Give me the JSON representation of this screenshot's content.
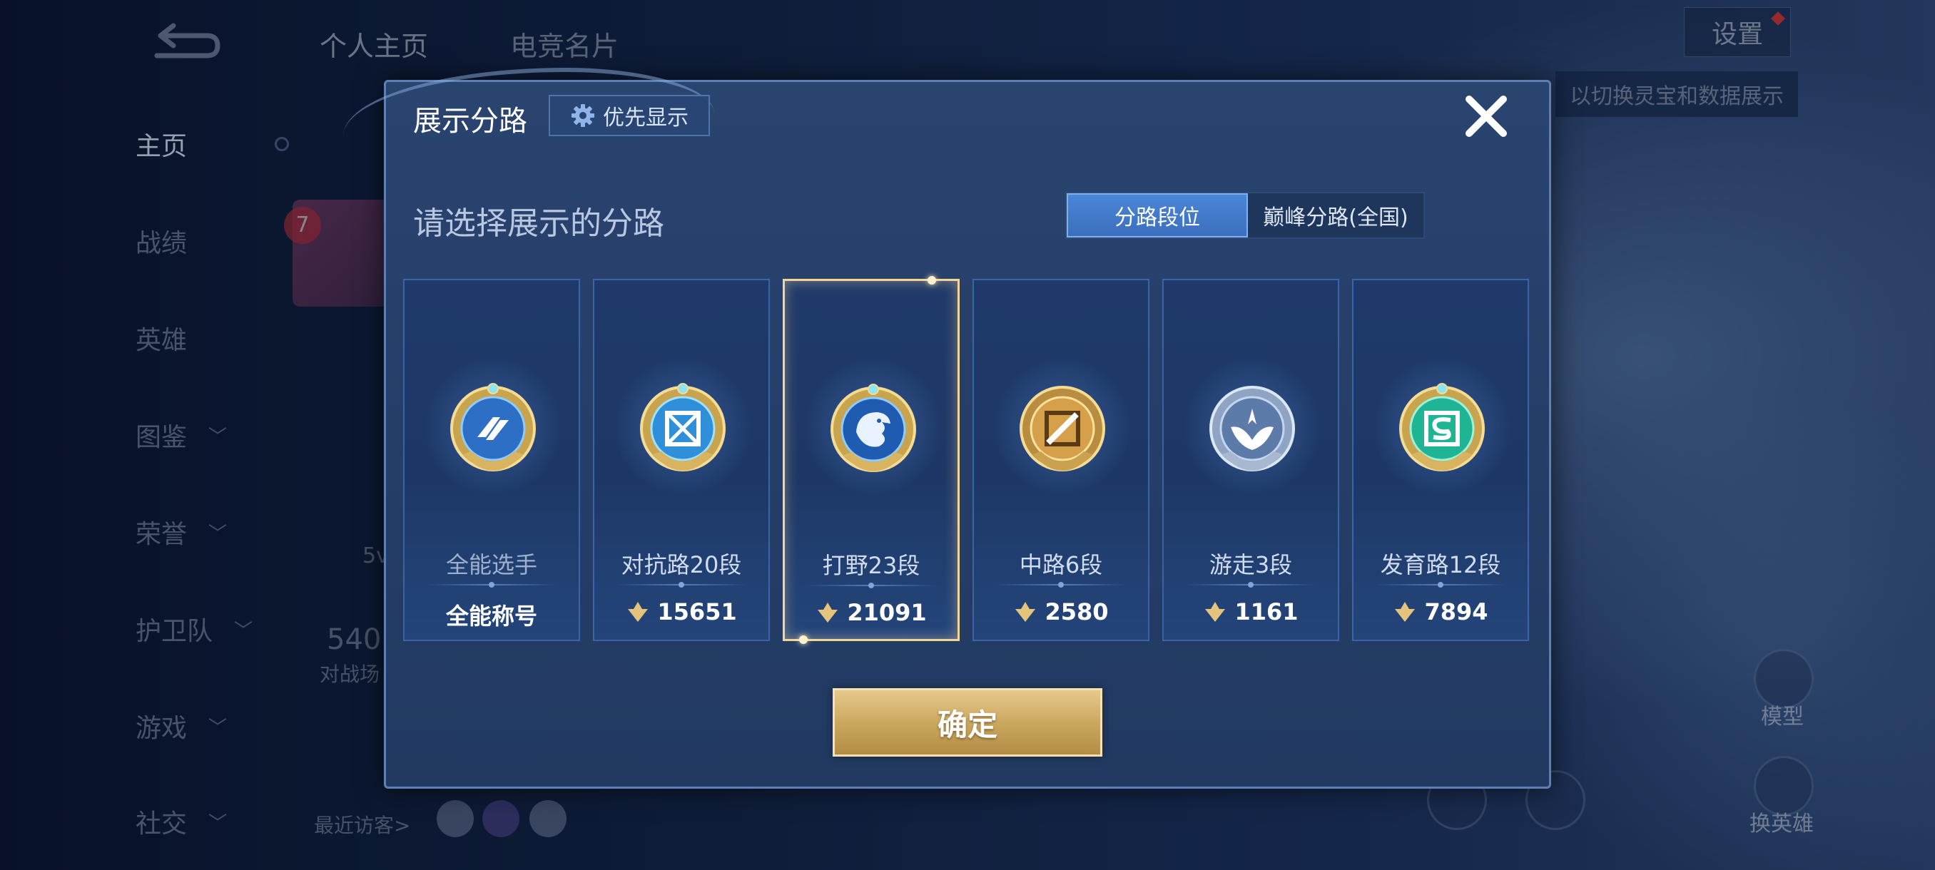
{
  "nav": {
    "items": [
      {
        "label": "主页",
        "active": true,
        "has_chevron": false
      },
      {
        "label": "战绩",
        "has_chevron": false
      },
      {
        "label": "英雄",
        "has_chevron": false
      },
      {
        "label": "图鉴",
        "has_chevron": true
      },
      {
        "label": "荣誉",
        "has_chevron": true
      },
      {
        "label": "护卫队",
        "has_chevron": true
      },
      {
        "label": "游戏",
        "has_chevron": true
      },
      {
        "label": "社交",
        "has_chevron": true
      }
    ]
  },
  "top_tabs": [
    "个人主页",
    "电竞名片"
  ],
  "settings_label": "设置",
  "top_hint": "以切换灵宝和数据展示",
  "background": {
    "battle_count": "540",
    "battle_label": "对战场",
    "fragment_5v": "5v",
    "recent_visitors_label": "最近访客>",
    "rank_badge": "7",
    "side_buttons": [
      "模型",
      "换英雄"
    ]
  },
  "dialog": {
    "title": "展示分路",
    "priority_label": "优先显示",
    "subtitle": "请选择展示的分路",
    "segments": [
      {
        "label": "分路段位",
        "active": true
      },
      {
        "label": "巅峰分路(全国)",
        "active": false
      }
    ],
    "cards": [
      {
        "name": "全能选手",
        "bottom": "全能称号",
        "icon": "all-round-emblem",
        "selected": false
      },
      {
        "name": "对抗路20段",
        "bottom": "15651",
        "icon": "clash-lane-emblem",
        "selected": false
      },
      {
        "name": "打野23段",
        "bottom": "21091",
        "icon": "jungle-emblem",
        "selected": true
      },
      {
        "name": "中路6段",
        "bottom": "2580",
        "icon": "mid-lane-emblem",
        "selected": false
      },
      {
        "name": "游走3段",
        "bottom": "1161",
        "icon": "roam-emblem",
        "selected": false
      },
      {
        "name": "发育路12段",
        "bottom": "7894",
        "icon": "farm-lane-emblem",
        "selected": false
      }
    ],
    "confirm_label": "确定"
  },
  "colors": {
    "dialog_bg": "#253e68",
    "selected_border": "#f2d59a",
    "segment_active": "#3b6fbd",
    "confirm_gold": "#c9a55c"
  }
}
